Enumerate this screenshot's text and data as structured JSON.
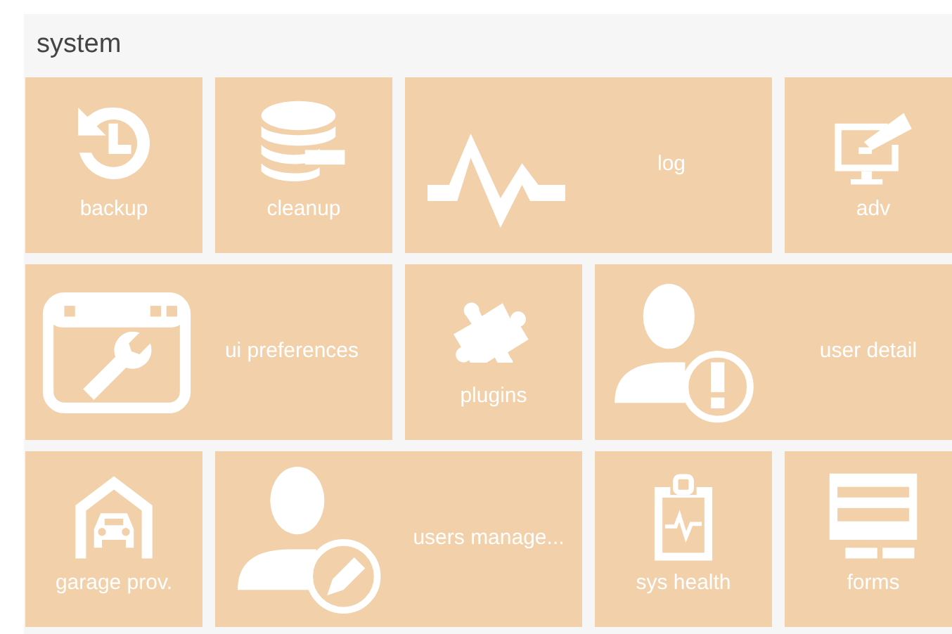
{
  "section": {
    "title": "system"
  },
  "tiles": [
    {
      "label": "backup",
      "kind": "small"
    },
    {
      "label": "cleanup",
      "kind": "small"
    },
    {
      "label": "log",
      "kind": "wide"
    },
    {
      "label": "adv",
      "kind": "small"
    },
    {
      "label": "ui preferences",
      "kind": "wide"
    },
    {
      "label": "plugins",
      "kind": "small"
    },
    {
      "label": "user detail",
      "kind": "wide"
    },
    {
      "label": "garage prov.",
      "kind": "small"
    },
    {
      "label": "users manage...",
      "kind": "wide"
    },
    {
      "label": "sys health",
      "kind": "small"
    },
    {
      "label": "forms",
      "kind": "small"
    }
  ]
}
